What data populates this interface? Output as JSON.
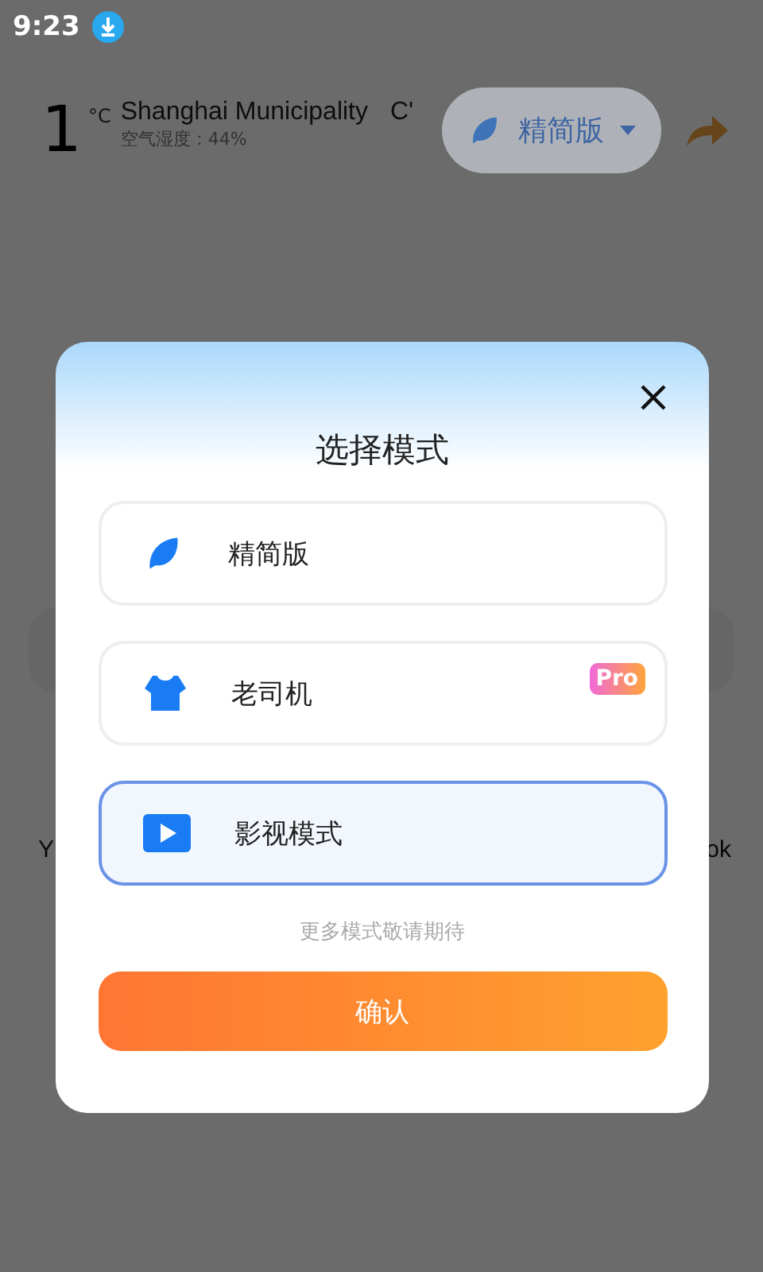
{
  "status_bar": {
    "time": "9:23"
  },
  "header": {
    "temperature": "1",
    "unit": "°C",
    "city": "Shanghai Municipality",
    "city_extra": "C'",
    "humidity": "空气湿度：44%",
    "mode_pill": {
      "label": "精简版"
    }
  },
  "background_fragments": {
    "left": "Y",
    "right": "ok"
  },
  "dialog": {
    "title": "选择模式",
    "modes": [
      {
        "label": "精简版",
        "selected": false
      },
      {
        "label": "老司机",
        "selected": false,
        "badge": "Pro"
      },
      {
        "label": "影视模式",
        "selected": true
      }
    ],
    "hint": "更多模式敬请期待",
    "confirm": "确认"
  }
}
